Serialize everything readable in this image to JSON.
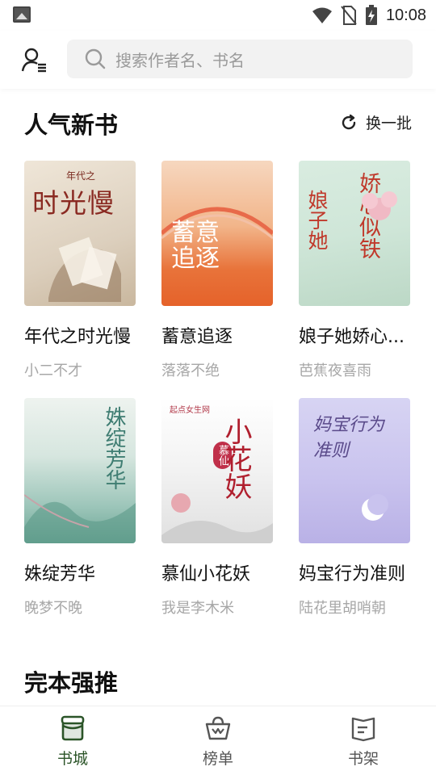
{
  "status": {
    "time": "10:08"
  },
  "search": {
    "placeholder": "搜索作者名、书名"
  },
  "section_new": {
    "title": "人气新书",
    "refresh_label": "换一批"
  },
  "books": [
    {
      "title": "年代之时光慢",
      "author": "小二不才",
      "cover_text": "时光慢",
      "cover_small": "年代之"
    },
    {
      "title": "蓄意追逐",
      "author": "落落不绝",
      "cover_text": "蓄意追逐"
    },
    {
      "title": "娘子她娇心...",
      "author": "芭蕉夜喜雨",
      "cover_text": "娇心似铁",
      "cover_text2": "娘子她"
    },
    {
      "title": "姝绽芳华",
      "author": "晚梦不晚",
      "cover_text": "姝绽芳华"
    },
    {
      "title": "慕仙小花妖",
      "author": "我是李木米",
      "cover_text": "小花妖",
      "cover_small": "慕仙",
      "cover_brand": "起点女生网"
    },
    {
      "title": "妈宝行为准则",
      "author": "陆花里胡哨朝",
      "cover_text": "妈宝行为准则"
    }
  ],
  "section_complete": {
    "title": "完本强推"
  },
  "tabs": [
    {
      "label": "书城",
      "icon": "store-icon",
      "active": true
    },
    {
      "label": "榜单",
      "icon": "crown-basket-icon",
      "active": false
    },
    {
      "label": "书架",
      "icon": "bookshelf-icon",
      "active": false
    }
  ],
  "colors": {
    "accent": "#2b5428",
    "muted": "#a7a7a7"
  }
}
